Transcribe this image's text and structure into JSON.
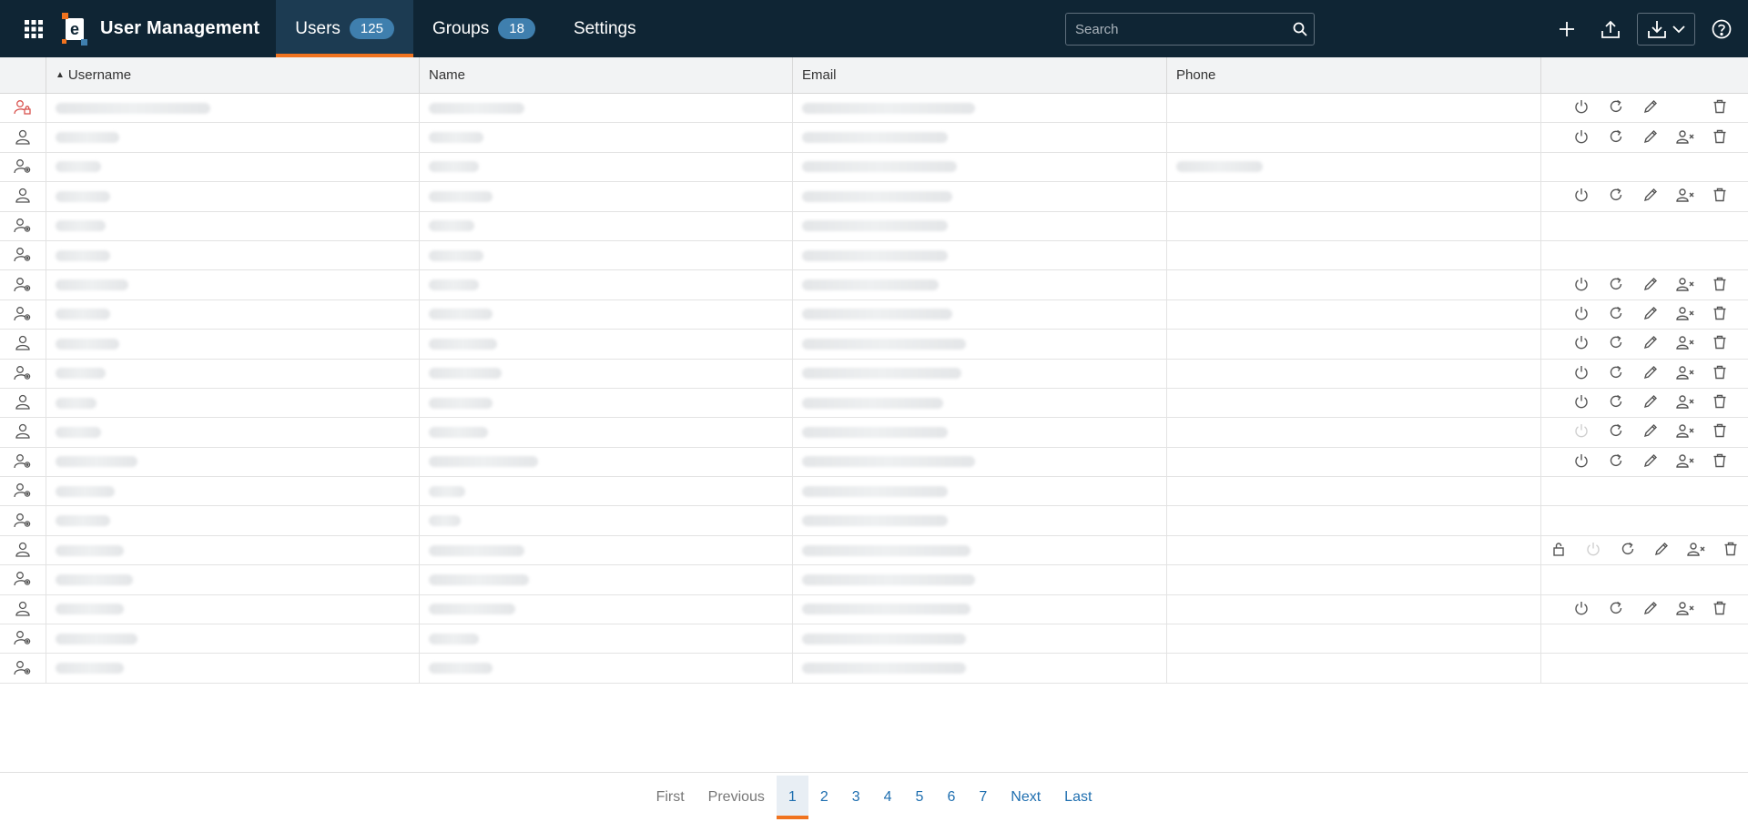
{
  "app": {
    "title": "User Management"
  },
  "nav": {
    "tabs": [
      {
        "label": "Users",
        "badge": "125",
        "active": true
      },
      {
        "label": "Groups",
        "badge": "18",
        "active": false
      },
      {
        "label": "Settings",
        "badge": null,
        "active": false
      }
    ]
  },
  "search": {
    "placeholder": "Search",
    "value": ""
  },
  "toolbar": {
    "icons": [
      "add-icon",
      "upload-icon",
      "download-icon",
      "chevron-down-icon",
      "help-icon"
    ]
  },
  "table": {
    "columns": [
      "",
      "Username",
      "Name",
      "Email",
      "Phone",
      ""
    ],
    "sort": {
      "column": "Username",
      "direction": "asc"
    },
    "rows": [
      {
        "user_icon": "user-lock-icon",
        "actions": [
          "power",
          "reset",
          "edit",
          "",
          "delete"
        ]
      },
      {
        "user_icon": "user-icon",
        "actions": [
          "power",
          "reset",
          "edit",
          "remove-user",
          "delete"
        ]
      },
      {
        "user_icon": "user-gear-icon",
        "actions": []
      },
      {
        "user_icon": "user-icon",
        "actions": [
          "power",
          "reset",
          "edit",
          "remove-user",
          "delete"
        ]
      },
      {
        "user_icon": "user-gear-icon",
        "actions": []
      },
      {
        "user_icon": "user-gear-icon",
        "actions": []
      },
      {
        "user_icon": "user-gear-icon",
        "actions": [
          "power",
          "reset",
          "edit",
          "remove-user",
          "delete"
        ]
      },
      {
        "user_icon": "user-gear-icon",
        "actions": [
          "power",
          "reset",
          "edit",
          "remove-user",
          "delete"
        ]
      },
      {
        "user_icon": "user-icon",
        "actions": [
          "power",
          "reset",
          "edit",
          "remove-user",
          "delete"
        ]
      },
      {
        "user_icon": "user-gear-icon",
        "actions": [
          "power",
          "reset",
          "edit",
          "remove-user",
          "delete"
        ]
      },
      {
        "user_icon": "user-icon",
        "actions": [
          "power",
          "reset",
          "edit",
          "remove-user",
          "delete"
        ]
      },
      {
        "user_icon": "user-icon",
        "actions": [
          "power-dim",
          "reset",
          "edit",
          "remove-user",
          "delete"
        ]
      },
      {
        "user_icon": "user-gear-icon",
        "actions": [
          "power",
          "reset",
          "edit",
          "remove-user",
          "delete"
        ]
      },
      {
        "user_icon": "user-gear-icon",
        "actions": []
      },
      {
        "user_icon": "user-gear-icon",
        "actions": []
      },
      {
        "user_icon": "user-icon",
        "actions": [
          "unlock",
          "power-dim",
          "reset",
          "edit",
          "remove-user",
          "delete"
        ]
      },
      {
        "user_icon": "user-gear-icon",
        "actions": []
      },
      {
        "user_icon": "user-icon",
        "actions": [
          "power",
          "reset",
          "edit",
          "remove-user",
          "delete"
        ]
      },
      {
        "user_icon": "user-gear-icon",
        "actions": []
      },
      {
        "user_icon": "user-gear-icon",
        "actions": []
      }
    ]
  },
  "pagination": {
    "first": "First",
    "previous": "Previous",
    "pages": [
      "1",
      "2",
      "3",
      "4",
      "5",
      "6",
      "7"
    ],
    "current": "1",
    "next": "Next",
    "last": "Last"
  },
  "colors": {
    "topbar": "#0f2534",
    "accent": "#f0731f",
    "link": "#1f6fb0",
    "badge": "#3f7fae"
  }
}
